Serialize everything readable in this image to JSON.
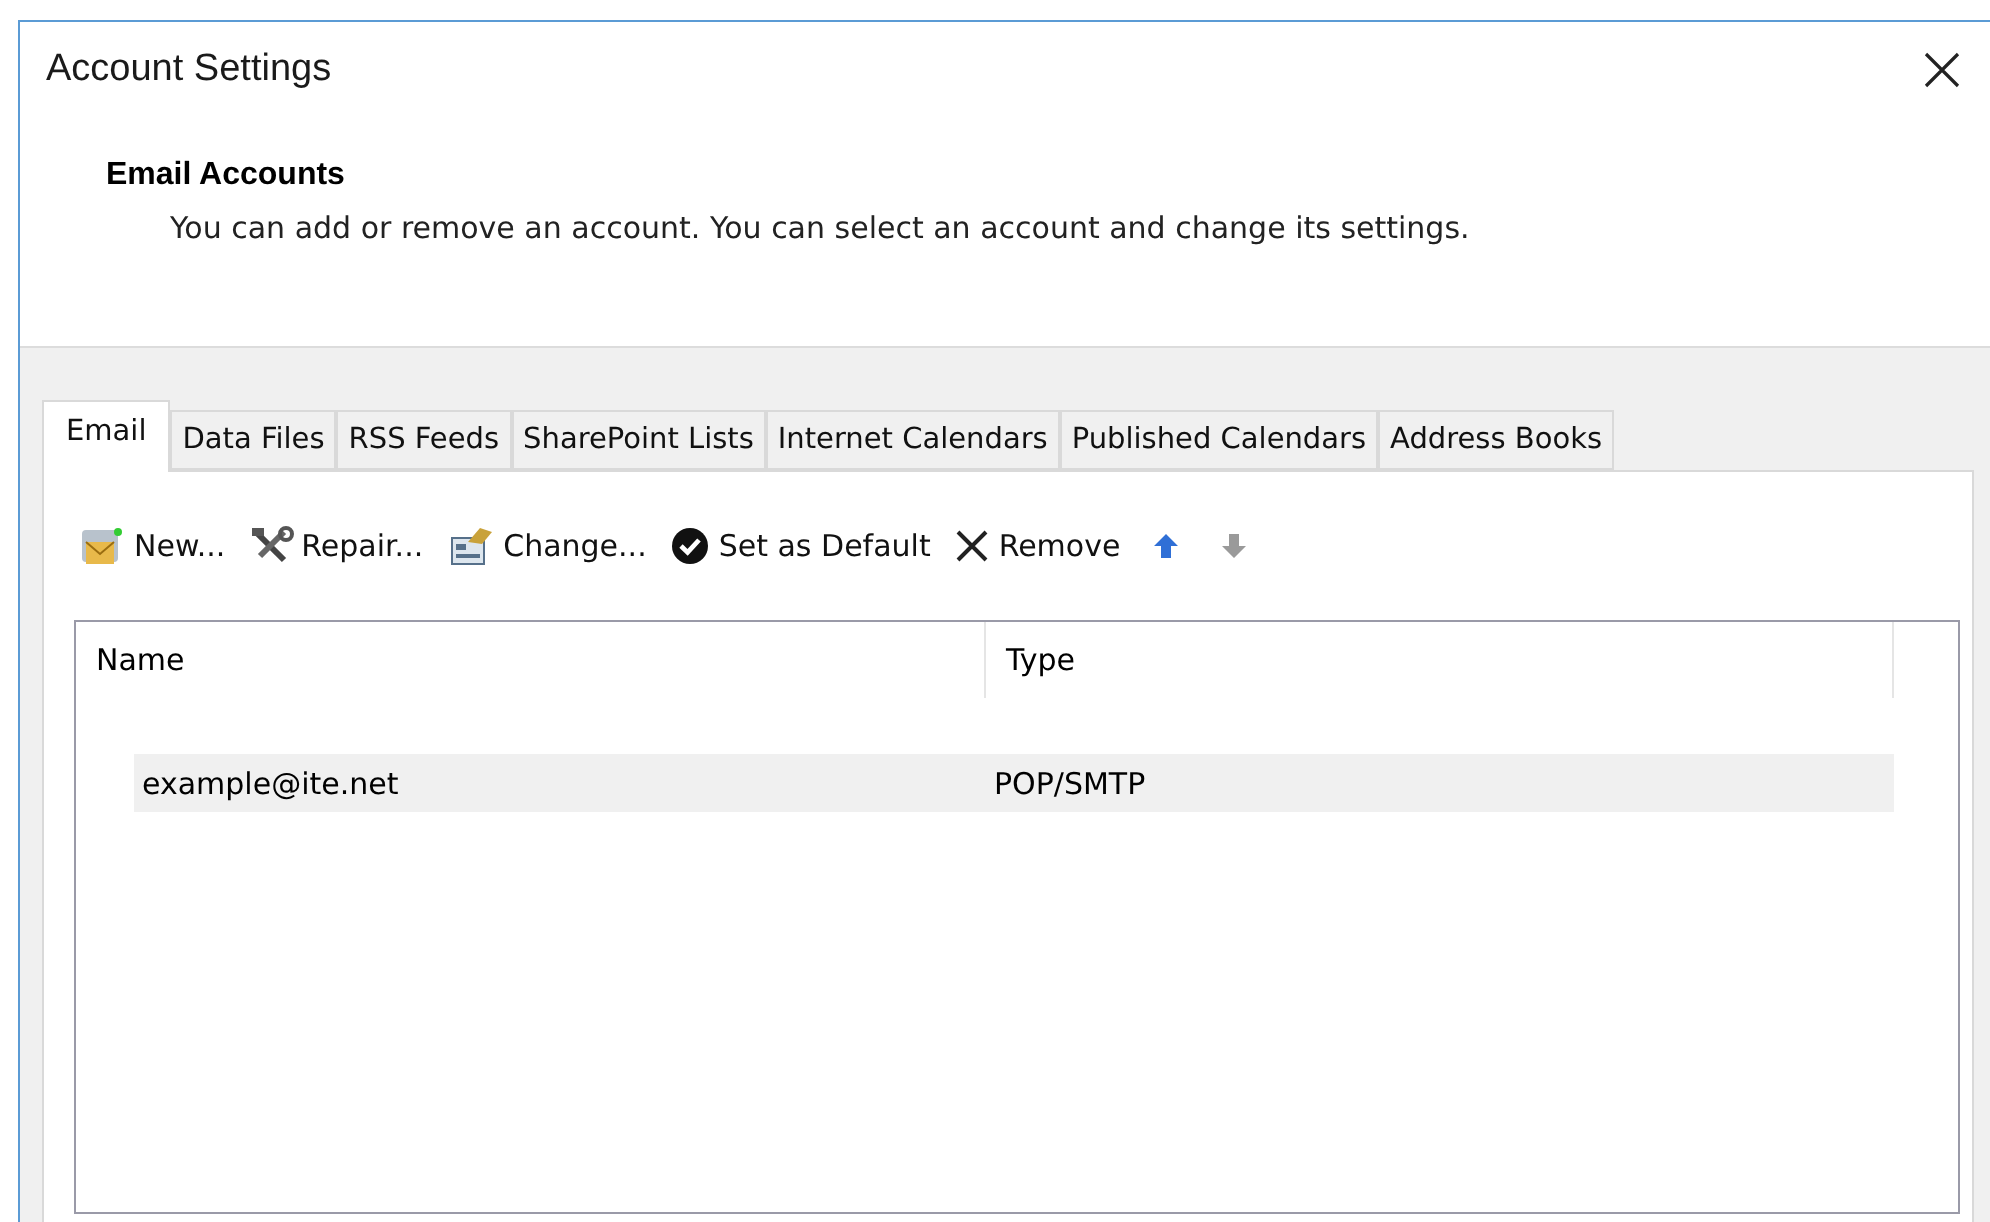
{
  "window": {
    "title": "Account Settings"
  },
  "header": {
    "title": "Email Accounts",
    "description": "You can add or remove an account. You can select an account and change its settings."
  },
  "tabs": [
    {
      "label": "Email",
      "selected": true
    },
    {
      "label": "Data Files",
      "selected": false
    },
    {
      "label": "RSS Feeds",
      "selected": false
    },
    {
      "label": "SharePoint Lists",
      "selected": false
    },
    {
      "label": "Internet Calendars",
      "selected": false
    },
    {
      "label": "Published Calendars",
      "selected": false
    },
    {
      "label": "Address Books",
      "selected": false
    }
  ],
  "toolbar": [
    {
      "kind": "new",
      "label": "New...",
      "disabled": false
    },
    {
      "kind": "repair",
      "label": "Repair...",
      "disabled": false
    },
    {
      "kind": "change",
      "label": "Change...",
      "disabled": false
    },
    {
      "kind": "default",
      "label": "Set as Default",
      "disabled": false
    },
    {
      "kind": "remove",
      "label": "Remove",
      "disabled": false
    },
    {
      "kind": "up",
      "disabled": false
    },
    {
      "kind": "down",
      "disabled": true
    }
  ],
  "table": {
    "columns": [
      "Name",
      "Type"
    ],
    "rows": [
      {
        "cells": [
          "example@ite.net",
          "POP/SMTP"
        ],
        "selected": true
      }
    ]
  }
}
